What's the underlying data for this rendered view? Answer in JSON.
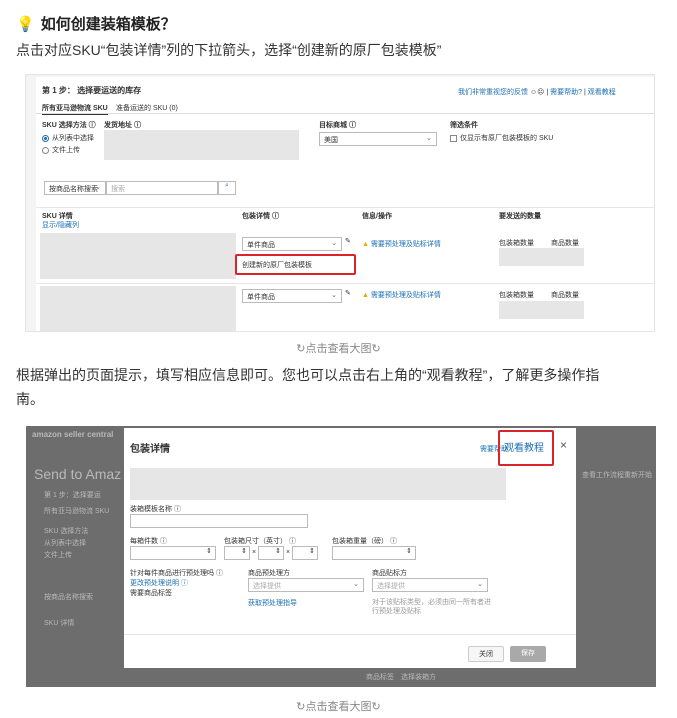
{
  "article": {
    "heading": "如何创建装箱模板？",
    "instruction1": "点击对应SKU“包装详情”列的下拉箭头，选择“创建新的原厂包装模板”",
    "caption": "点击查看大图",
    "instruction2_line1": "根据弹出的页面提示，填写相应信息即可。您也可以点击右上角的“观看教程”，了解更多操作指",
    "instruction2_line2": "南。"
  },
  "shot1": {
    "step_title": "第 1 步： 选择要运送的库存",
    "feedback_link": "我们非常重视您的反馈",
    "need_help": "需要帮助?",
    "watch_tutorial": "观看教程",
    "tabs": [
      "所有亚马逊物流 SKU",
      "准备运送的 SKU (0)"
    ],
    "sku_method_label": "SKU 选择方法",
    "ship_from_label": "发货地址",
    "destination_label": "目标商城",
    "filter_label": "筛选条件",
    "method_options": [
      "从列表中选择",
      "文件上传"
    ],
    "destination_value": "美国",
    "filter_option": "仅显示有原厂包装模板的 SKU",
    "search_select": "按商品名称搜索",
    "search_placeholder": "搜索",
    "columns": [
      "SKU 详情",
      "包装详情",
      "信息/操作",
      "要发送的数量"
    ],
    "show_hide": "显示/隐藏列",
    "rows": [
      {
        "pack": "单件商品",
        "info": "需要预处理及贴标详情",
        "qty_labels": [
          "包装箱数量",
          "商品数量"
        ]
      },
      {
        "pack": "单件商品",
        "info": "需要预处理及贴标详情",
        "qty_labels": [
          "包装箱数量",
          "商品数量"
        ]
      }
    ],
    "dropdown_option": "创建新的原厂包装模板"
  },
  "shot2": {
    "modal_title": "包装详情",
    "need_help": "需要帮助",
    "watch_tutorial": "观看教程",
    "close_x": "×",
    "template_name_label": "装箱模板名称",
    "units_label": "每箱件数",
    "box_dims_label": "包装箱尺寸（英寸）",
    "box_weight_label": "包装箱重量（磅）",
    "prep_required_label": "针对每件商品进行预处理吗",
    "prep_link": "更改预处理说明",
    "prep_note": "需要商品标签",
    "who_preps_label": "商品预处理方",
    "who_labels_label": "商品贴标方",
    "select_placeholder": "选择提供",
    "prep_guide_link": "获取预处理指导",
    "label_note": "对于该贴标类型，必须由同一所有者进行预处理及贴标",
    "close_button": "关闭",
    "save_button": "保存",
    "bg_brand": "amazon seller central",
    "bg_title": "Send to Amaz",
    "bg_step": "第 1 步：选择要运",
    "bg_tab": "所有亚马逊物流 SKU",
    "bg_method": "SKU 选择方法",
    "bg_opt1": "从列表中选择",
    "bg_opt2": "文件上传",
    "bg_search": "按商品名称搜索",
    "bg_sku": "SKU 详情",
    "bg_right1": "查看工作流程",
    "bg_right2": "重新开始",
    "bg_footer": "商品标签　选择装箱方"
  }
}
